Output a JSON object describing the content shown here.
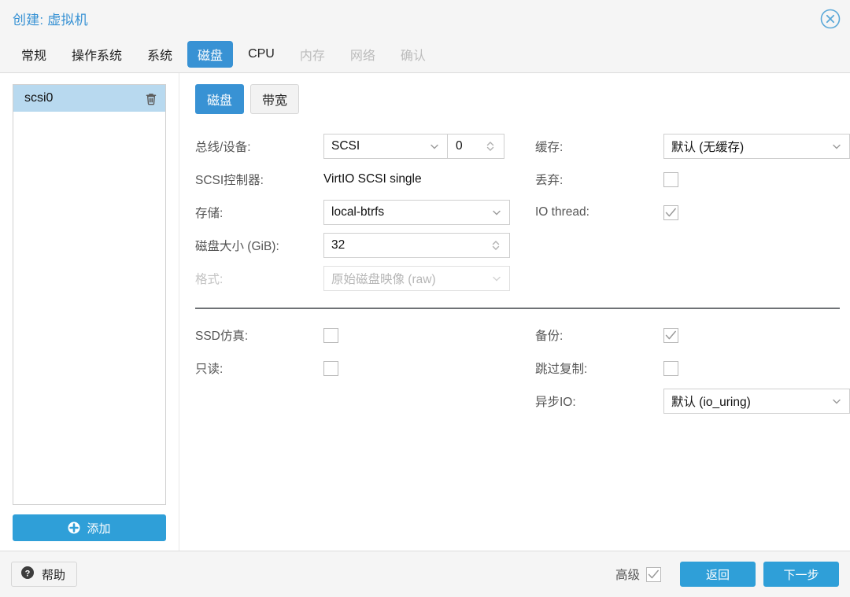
{
  "window": {
    "title": "创建: 虚拟机",
    "close_icon": "close-circle-icon"
  },
  "tabs": [
    {
      "label": "常规",
      "state": "normal"
    },
    {
      "label": "操作系统",
      "state": "normal"
    },
    {
      "label": "系统",
      "state": "normal"
    },
    {
      "label": "磁盘",
      "state": "active"
    },
    {
      "label": "CPU",
      "state": "normal"
    },
    {
      "label": "内存",
      "state": "disabled"
    },
    {
      "label": "网络",
      "state": "disabled"
    },
    {
      "label": "确认",
      "state": "disabled"
    }
  ],
  "devices": {
    "items": [
      {
        "name": "scsi0",
        "selected": true,
        "delete_icon": "trash-icon"
      }
    ],
    "add_label": "添加",
    "add_icon": "plus-circle-icon"
  },
  "subtabs": [
    {
      "label": "磁盘",
      "state": "active"
    },
    {
      "label": "带宽",
      "state": "normal"
    }
  ],
  "form": {
    "left": {
      "bus_device_label": "总线/设备:",
      "bus_value": "SCSI",
      "device_index": "0",
      "scsi_controller_label": "SCSI控制器:",
      "scsi_controller_value": "VirtIO SCSI single",
      "storage_label": "存储:",
      "storage_value": "local-btrfs",
      "disk_size_label": "磁盘大小 (GiB):",
      "disk_size_value": "32",
      "format_label": "格式:",
      "format_value": "原始磁盘映像 (raw)"
    },
    "right": {
      "cache_label": "缓存:",
      "cache_value": "默认 (无缓存)",
      "discard_label": "丢弃:",
      "discard_checked": false,
      "iothread_label": "IO thread:",
      "iothread_checked": true
    },
    "advanced_left": {
      "ssd_emulation_label": "SSD仿真:",
      "ssd_emulation_checked": false,
      "readonly_label": "只读:",
      "readonly_checked": false
    },
    "advanced_right": {
      "backup_label": "备份:",
      "backup_checked": true,
      "skip_replication_label": "跳过复制:",
      "skip_replication_checked": false,
      "async_io_label": "异步IO:",
      "async_io_value": "默认 (io_uring)"
    }
  },
  "footer": {
    "help_label": "帮助",
    "help_icon": "question-circle-icon",
    "advanced_label": "高级",
    "advanced_checked": true,
    "back_label": "返回",
    "next_label": "下一步"
  },
  "colors": {
    "accent": "#3892d4",
    "button_blue": "#2f9fd8",
    "selected_row": "#b8d9ef",
    "label_text": "#555555",
    "disabled_text": "#bcbcbc"
  }
}
